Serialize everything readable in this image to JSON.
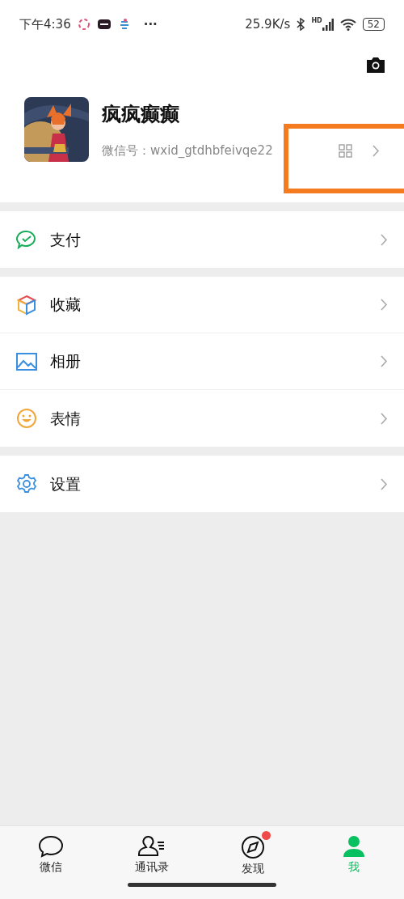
{
  "status_bar": {
    "time": "下午4:36",
    "more": "···",
    "speed": "25.9K/s",
    "network": "HD",
    "battery": "52"
  },
  "profile": {
    "name": "疯疯癫癫",
    "wechat_id": "微信号：wxid_gtdhbfeivqe22",
    "highlighted": true
  },
  "sections": [
    {
      "items": [
        {
          "label": "支付",
          "kind": "pay"
        }
      ]
    },
    {
      "items": [
        {
          "label": "收藏",
          "kind": "favorites"
        },
        {
          "label": "相册",
          "kind": "album"
        },
        {
          "label": "表情",
          "kind": "stickers"
        }
      ]
    },
    {
      "items": [
        {
          "label": "设置",
          "kind": "settings"
        }
      ]
    }
  ],
  "tabbar": [
    {
      "label": "微信",
      "kind": "chats",
      "selected": false,
      "badge": false
    },
    {
      "label": "通讯录",
      "kind": "contacts",
      "selected": false,
      "badge": false
    },
    {
      "label": "发现",
      "kind": "discover",
      "selected": false,
      "badge": true
    },
    {
      "label": "我",
      "kind": "me",
      "selected": true,
      "badge": false
    }
  ]
}
